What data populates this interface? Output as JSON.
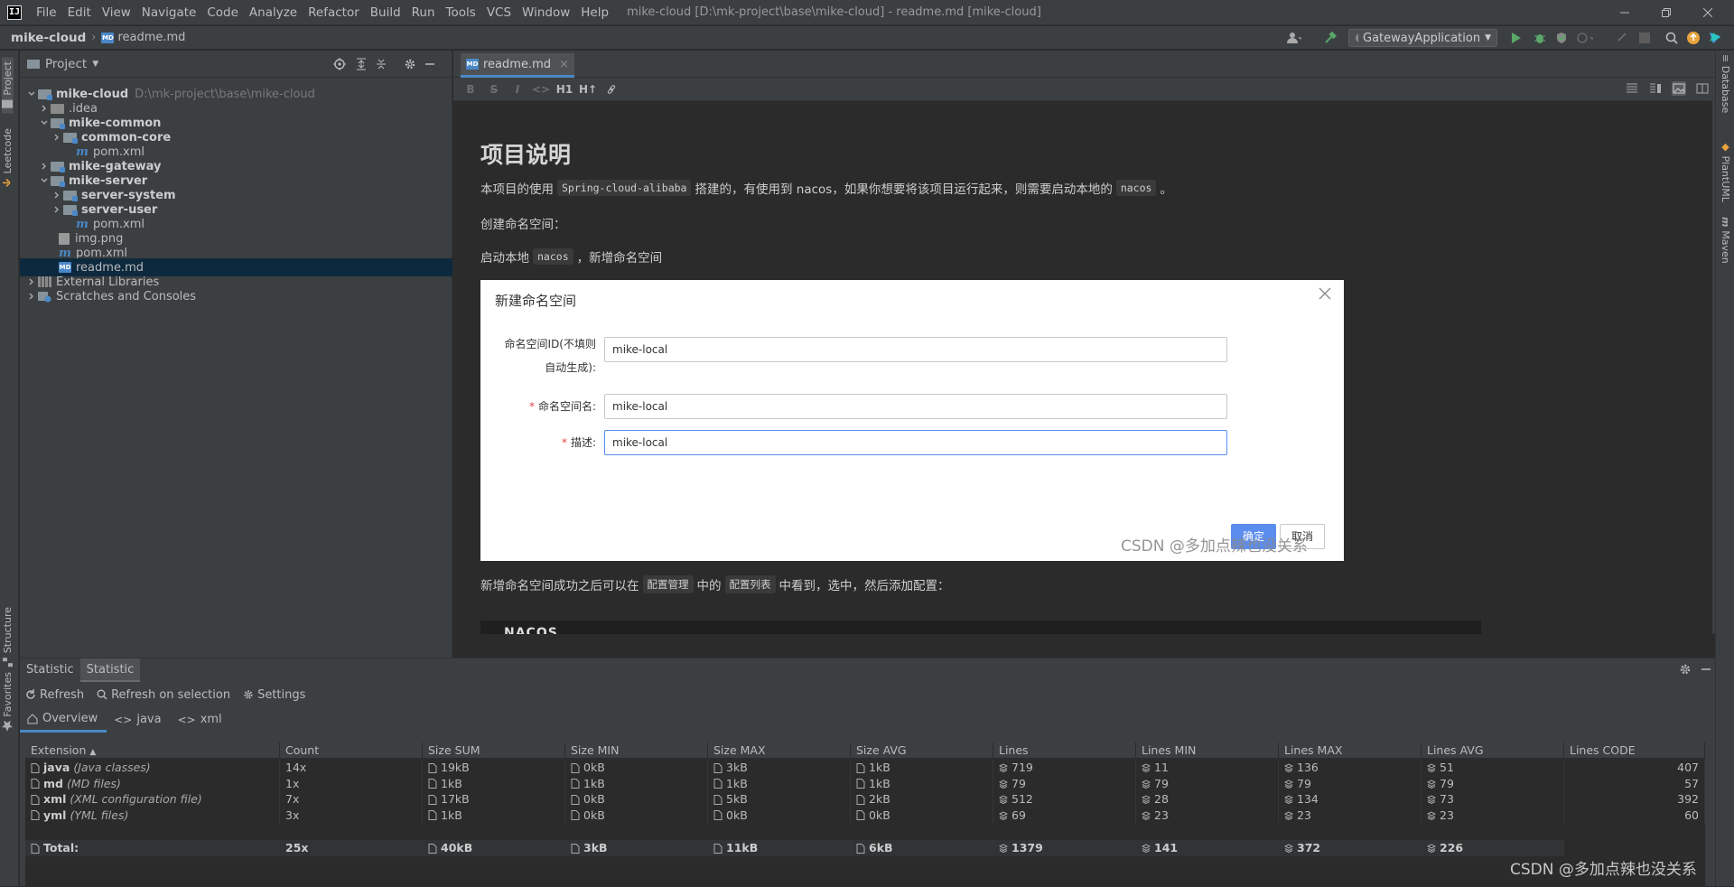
{
  "app": {
    "logo": "IJ",
    "menu": [
      "File",
      "Edit",
      "View",
      "Navigate",
      "Code",
      "Analyze",
      "Refactor",
      "Build",
      "Run",
      "Tools",
      "VCS",
      "Window",
      "Help"
    ],
    "window_title": "mike-cloud [D:\\mk-project\\base\\mike-cloud] - readme.md [mike-cloud]"
  },
  "navbar": {
    "project": "mike-cloud",
    "file": "readme.md",
    "run_config": "GatewayApplication"
  },
  "left_stripe": {
    "project": "Project",
    "leetcode": "Leetcode",
    "structure": "Structure",
    "favorites": "Favorites"
  },
  "right_stripe": {
    "database": "Database",
    "plantuml": "PlantUML",
    "maven": "Maven"
  },
  "project_panel": {
    "title": "Project",
    "tree": [
      {
        "label": "mike-cloud",
        "hint": "D:\\mk-project\\base\\mike-cloud"
      },
      {
        "label": ".idea"
      },
      {
        "label": "mike-common"
      },
      {
        "label": "common-core"
      },
      {
        "label": "pom.xml"
      },
      {
        "label": "mike-gateway"
      },
      {
        "label": "mike-server"
      },
      {
        "label": "server-system"
      },
      {
        "label": "server-user"
      },
      {
        "label": "pom.xml"
      },
      {
        "label": "img.png"
      },
      {
        "label": "pom.xml"
      },
      {
        "label": "readme.md"
      },
      {
        "label": "External Libraries"
      },
      {
        "label": "Scratches and Consoles"
      }
    ]
  },
  "editor": {
    "tab": "readme.md",
    "toolbar": [
      "B",
      "S",
      "I",
      "<>",
      "H1",
      "H↑"
    ],
    "heading": "项目说明",
    "p1": {
      "a": "本项目的使用",
      "code1": "Spring-cloud-alibaba",
      "b": "搭建的，有使用到 nacos，如果你想要将该项目运行起来，则需要启动本地的",
      "code2": "nacos",
      "c": "。"
    },
    "p2": "创建命名空间：",
    "p3": {
      "a": "启动本地",
      "code": "nacos",
      "b": "，新增命名空间"
    },
    "p4": {
      "a": "新增命名空间成功之后可以在",
      "code1": "配置管理",
      "b": "中的",
      "code2": "配置列表",
      "c": "中看到，选中，然后添加配置："
    },
    "nacos_logo": "NACOS"
  },
  "dialog": {
    "title": "新建命名空间",
    "id_label_1": "命名空间ID(不填则",
    "id_label_2": "自动生成):",
    "id_value": "mike-local",
    "name_label": "命名空间名:",
    "name_value": "mike-local",
    "desc_label": "描述:",
    "desc_value": "mike-local",
    "ok": "确定",
    "cancel": "取消",
    "watermark": "CSDN @多加点辣也没关系"
  },
  "statistic": {
    "tabs": [
      "Statistic",
      "Statistic"
    ],
    "actions": [
      "Refresh",
      "Refresh on selection",
      "Settings"
    ],
    "subtabs": [
      "Overview",
      "java",
      "xml"
    ],
    "columns": [
      "Extension",
      "Count",
      "Size SUM",
      "Size MIN",
      "Size MAX",
      "Size AVG",
      "Lines",
      "Lines MIN",
      "Lines MAX",
      "Lines AVG",
      "Lines CODE"
    ],
    "rows": [
      {
        "ext": "java",
        "desc": "(Java classes)",
        "count": "14x",
        "size_sum": "19kB",
        "size_min": "0kB",
        "size_max": "3kB",
        "size_avg": "1kB",
        "lines": "719",
        "lines_min": "11",
        "lines_max": "136",
        "lines_avg": "51",
        "lines_code": "407"
      },
      {
        "ext": "md",
        "desc": "(MD files)",
        "count": "1x",
        "size_sum": "1kB",
        "size_min": "1kB",
        "size_max": "1kB",
        "size_avg": "1kB",
        "lines": "79",
        "lines_min": "79",
        "lines_max": "79",
        "lines_avg": "79",
        "lines_code": "57"
      },
      {
        "ext": "xml",
        "desc": "(XML configuration file)",
        "count": "7x",
        "size_sum": "17kB",
        "size_min": "0kB",
        "size_max": "5kB",
        "size_avg": "2kB",
        "lines": "512",
        "lines_min": "28",
        "lines_max": "134",
        "lines_avg": "73",
        "lines_code": "392"
      },
      {
        "ext": "yml",
        "desc": "(YML files)",
        "count": "3x",
        "size_sum": "1kB",
        "size_min": "0kB",
        "size_max": "0kB",
        "size_avg": "0kB",
        "lines": "69",
        "lines_min": "23",
        "lines_max": "23",
        "lines_avg": "23",
        "lines_code": "60"
      }
    ],
    "total": {
      "label": "Total:",
      "count": "25x",
      "size_sum": "40kB",
      "size_min": "3kB",
      "size_max": "11kB",
      "size_avg": "6kB",
      "lines": "1379",
      "lines_min": "141",
      "lines_max": "372",
      "lines_avg": "226"
    }
  },
  "watermark": "CSDN @多加点辣也没关系",
  "colors": {
    "accent": "#4a88c7",
    "selection": "#0d293e",
    "dialog_primary": "#5b8def",
    "required": "#e54545"
  }
}
